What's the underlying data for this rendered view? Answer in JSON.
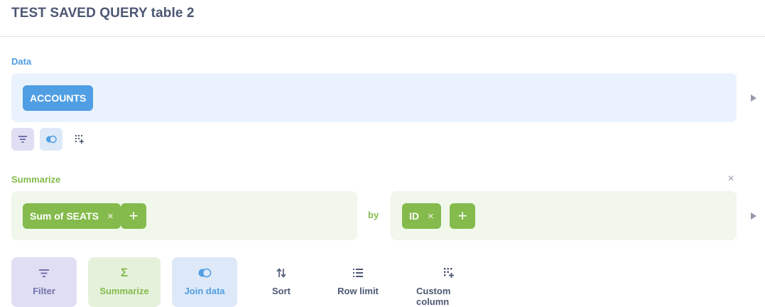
{
  "header": {
    "title": "TEST SAVED QUERY table 2"
  },
  "data_section": {
    "label": "Data",
    "table": "ACCOUNTS",
    "actions": [
      "filter-icon",
      "join-icon",
      "custom-column-icon"
    ]
  },
  "summarize_section": {
    "label": "Summarize",
    "metrics": [
      {
        "label": "Sum of SEATS"
      }
    ],
    "by_label": "by",
    "breakouts": [
      {
        "label": "ID"
      }
    ],
    "add_label": "+",
    "remove_label": "×"
  },
  "action_bar": [
    {
      "icon": "filter-icon",
      "label": "Filter"
    },
    {
      "icon": "sigma-icon",
      "label": "Summarize"
    },
    {
      "icon": "join-icon",
      "label": "Join data"
    },
    {
      "icon": "sort-icon",
      "label": "Sort"
    },
    {
      "icon": "list-icon",
      "label": "Row limit"
    },
    {
      "icon": "custom-column-icon",
      "label": "Custom column"
    }
  ],
  "colors": {
    "brand": "#509ee3",
    "summarize": "#84bb4c",
    "filter": "#7172ad",
    "text": "#4c5773",
    "muted": "#949aab"
  }
}
